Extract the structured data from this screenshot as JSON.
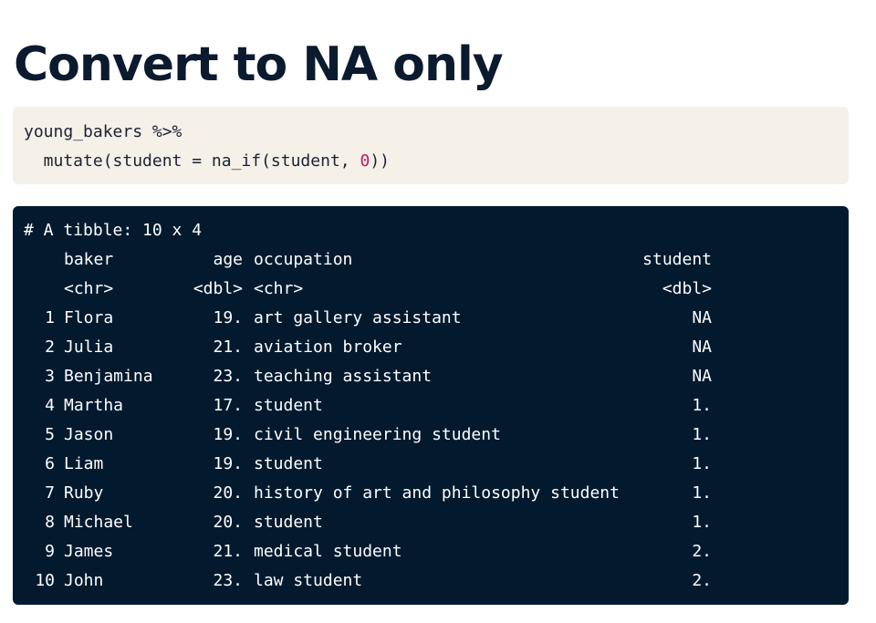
{
  "page": {
    "title": "Convert to NA only"
  },
  "code": {
    "line1": "young_bakers %>%",
    "line2_before": "  mutate(student = na_if(student, ",
    "line2_literal": "0",
    "line2_after": "))"
  },
  "output": {
    "header": "# A tibble: 10 x 4",
    "columns": [
      "baker",
      "age",
      "occupation",
      "student"
    ],
    "types": [
      "<chr>",
      "<dbl>",
      "<chr>",
      "<dbl>"
    ],
    "rows": [
      {
        "idx": "1",
        "baker": "Flora",
        "age": "19.",
        "occupation": "art gallery assistant",
        "student": "NA"
      },
      {
        "idx": "2",
        "baker": "Julia",
        "age": "21.",
        "occupation": "aviation broker",
        "student": "NA"
      },
      {
        "idx": "3",
        "baker": "Benjamina",
        "age": "23.",
        "occupation": "teaching assistant",
        "student": "NA"
      },
      {
        "idx": "4",
        "baker": "Martha",
        "age": "17.",
        "occupation": "student",
        "student": "1."
      },
      {
        "idx": "5",
        "baker": "Jason",
        "age": "19.",
        "occupation": "civil engineering student",
        "student": "1."
      },
      {
        "idx": "6",
        "baker": "Liam",
        "age": "19.",
        "occupation": "student",
        "student": "1."
      },
      {
        "idx": "7",
        "baker": "Ruby",
        "age": "20.",
        "occupation": "history of art and philosophy student",
        "student": "1."
      },
      {
        "idx": "8",
        "baker": "Michael",
        "age": "20.",
        "occupation": "student",
        "student": "1."
      },
      {
        "idx": "9",
        "baker": "James",
        "age": "21.",
        "occupation": "medical student",
        "student": "2."
      },
      {
        "idx": "10",
        "baker": "John",
        "age": "23.",
        "occupation": "law student",
        "student": "2."
      }
    ]
  },
  "colors": {
    "title": "#0b1a2e",
    "code_bg": "#f5f0e8",
    "output_bg": "#02192e",
    "numeric_literal": "#c2185b"
  }
}
